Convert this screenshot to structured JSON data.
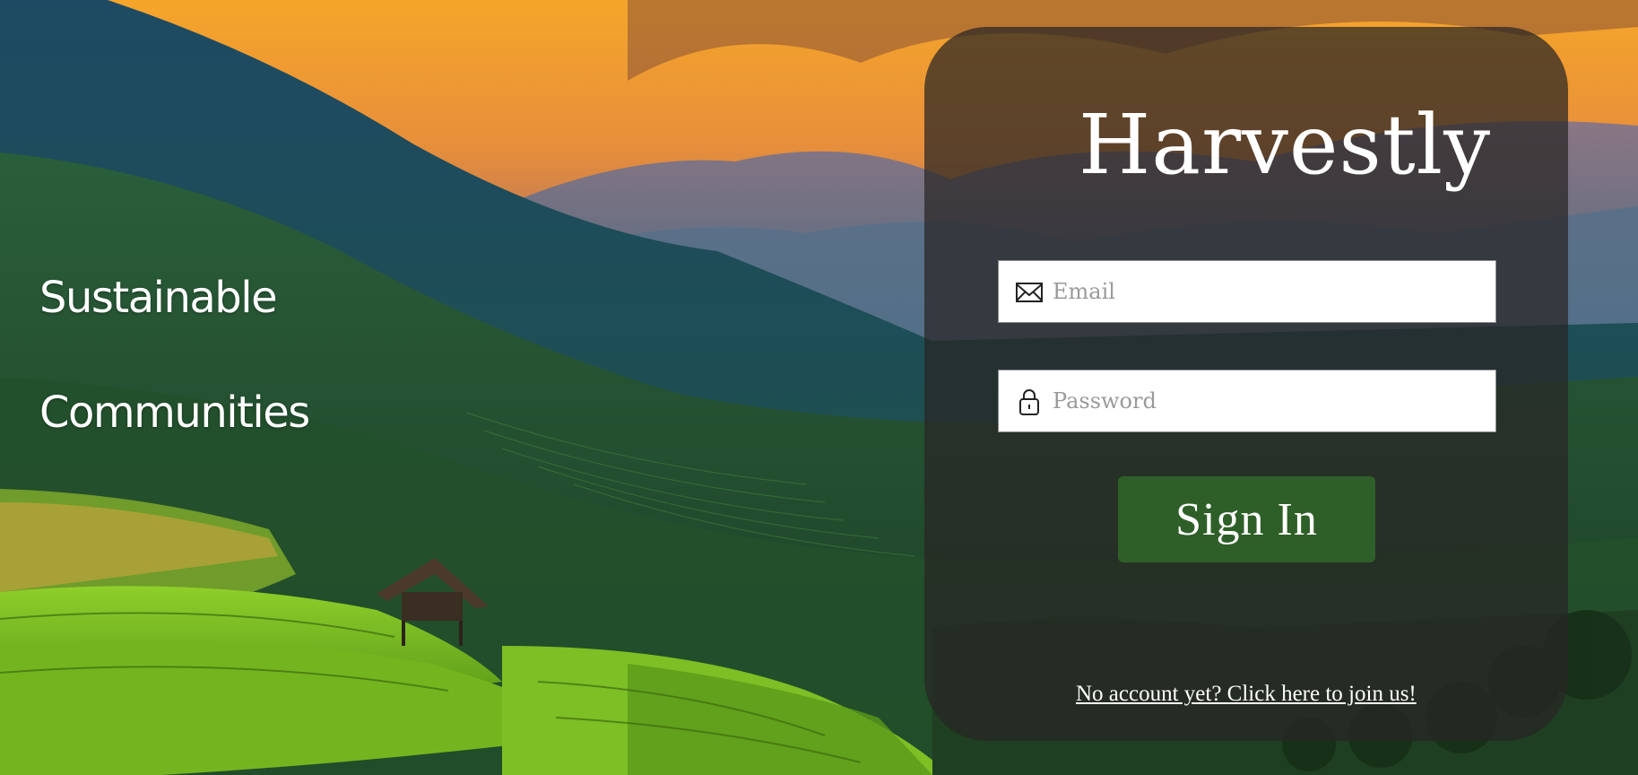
{
  "tagline": {
    "line1": "Sustainable",
    "line2": "Communities"
  },
  "login": {
    "brand": "Harvestly",
    "email_placeholder": "Email",
    "password_placeholder": "Password",
    "signin_label": "Sign In",
    "join_link": "No account yet? Click here to join us!"
  },
  "icons": {
    "email": "envelope-icon",
    "password": "lock-icon"
  },
  "colors": {
    "button_green": "#2f5f28",
    "panel_overlay": "rgba(40,38,36,0.72)",
    "text": "#ffffff"
  }
}
